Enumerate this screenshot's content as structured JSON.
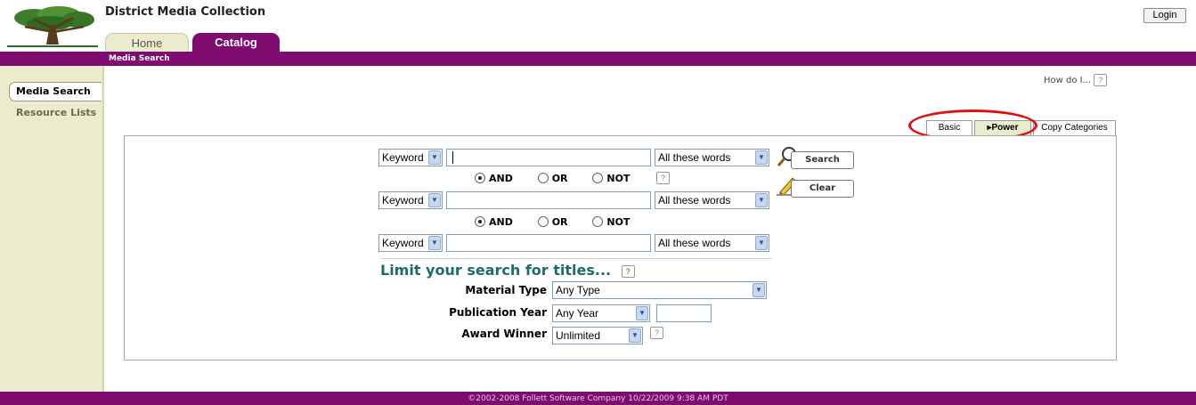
{
  "app": {
    "title": "District Media Collection",
    "login_label": "Login"
  },
  "tabs": [
    {
      "label": "Home"
    },
    {
      "label": "Catalog"
    }
  ],
  "breadcrumb": "Media Search",
  "sidebar": {
    "items": [
      {
        "label": "Media Search"
      },
      {
        "label": "Resource Lists"
      }
    ]
  },
  "help": {
    "how_do_i": "How do I...",
    "q": "?"
  },
  "search_modes": {
    "basic": "Basic",
    "power": "Power",
    "power_arrow": "▸",
    "copy": "Copy Categories"
  },
  "search": {
    "rows": [
      {
        "field": "Keyword",
        "value": "",
        "match": "All these words"
      },
      {
        "field": "Keyword",
        "value": "",
        "match": "All these words"
      },
      {
        "field": "Keyword",
        "value": "",
        "match": "All these words"
      }
    ],
    "operators": [
      {
        "and": "AND",
        "or": "OR",
        "not": "NOT",
        "selected": "AND"
      },
      {
        "and": "AND",
        "or": "OR",
        "not": "NOT",
        "selected": "AND"
      }
    ],
    "search_button": "Search",
    "clear_button": "Clear"
  },
  "limit": {
    "heading": "Limit your search for titles...",
    "material_type": {
      "label": "Material Type",
      "value": "Any Type"
    },
    "publication_year": {
      "label": "Publication Year",
      "value": "Any Year",
      "year_input": ""
    },
    "award_winner": {
      "label": "Award Winner",
      "value": "Unlimited"
    }
  },
  "footer": "©2002-2008  Follett Software Company    10/22/2009 9:38 AM PDT",
  "colors": {
    "brand": "#7d0c6e",
    "sidebar": "#ebeccd",
    "accent_red": "#e01010",
    "heading": "#1f6a6a"
  }
}
